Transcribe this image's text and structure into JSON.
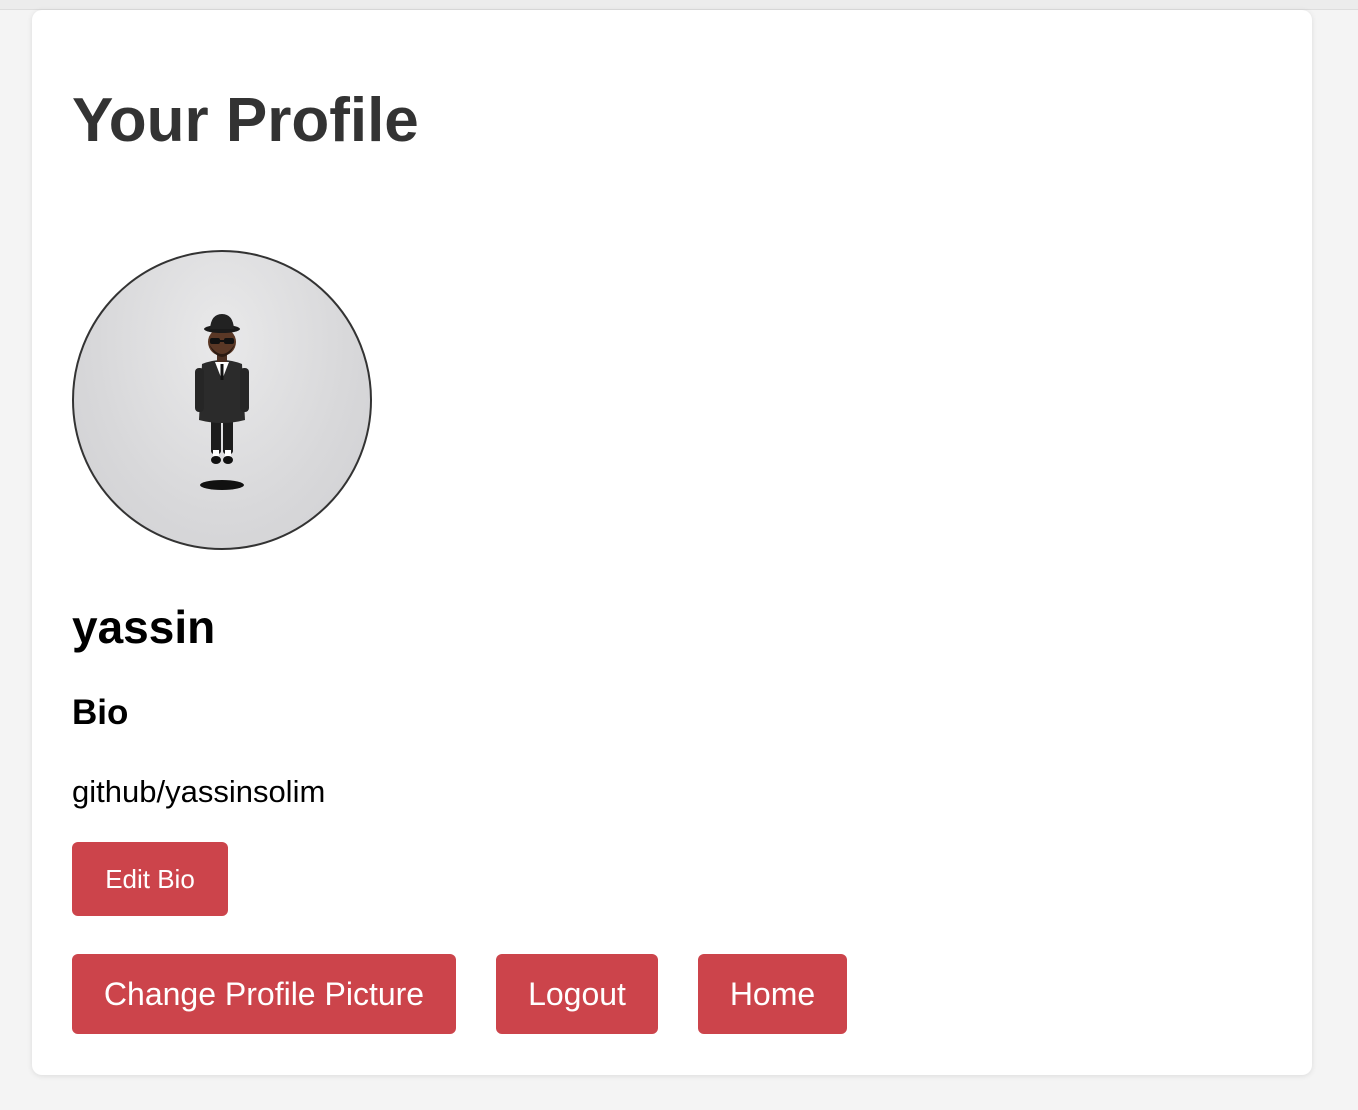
{
  "page": {
    "title": "Your Profile"
  },
  "profile": {
    "avatar_icon": "levitating-man-icon",
    "username": "yassin",
    "bio_heading": "Bio",
    "bio_text": "github/yassinsolim"
  },
  "actions": {
    "edit_bio": "Edit Bio",
    "change_picture": "Change Profile Picture",
    "logout": "Logout",
    "home": "Home"
  },
  "colors": {
    "button_bg": "#cc444b",
    "title_text": "#333333",
    "card_bg": "#ffffff",
    "page_bg": "#f4f4f4"
  }
}
